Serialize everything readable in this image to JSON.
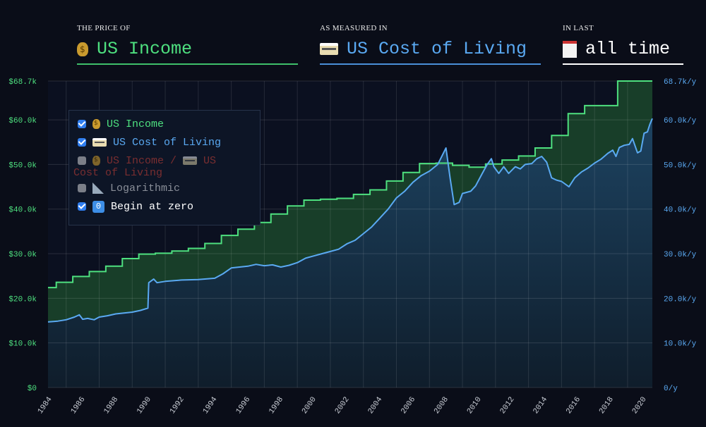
{
  "header": {
    "price_of": {
      "label": "THE PRICE OF",
      "value": "US Income",
      "icon": "money-bag-icon"
    },
    "measured_in": {
      "label": "AS MEASURED IN",
      "value": "US Cost of Living",
      "icon": "credit-card-icon"
    },
    "in_last": {
      "label": "IN LAST",
      "value": "all time",
      "icon": "spiral-notepad-icon"
    }
  },
  "legend": {
    "items": [
      {
        "label": "US Income",
        "checked": true,
        "icon": "money-bag-icon",
        "color": "#4ee07f"
      },
      {
        "label": "US Cost of Living",
        "checked": true,
        "icon": "credit-card-icon",
        "color": "#5aa9f2"
      },
      {
        "label_a": "US Income /",
        "label_b": "US",
        "label_c": "Cost of Living",
        "checked": false,
        "color": "#7a2e30"
      },
      {
        "label": "Logarithmic",
        "checked": false,
        "icon": "triangular-ruler-icon",
        "color": "#8a8f99"
      },
      {
        "label": "Begin at zero",
        "checked": true,
        "icon": "keycap-zero-icon",
        "icon_text": "0",
        "color": "#ffffff"
      }
    ]
  },
  "chart_data": {
    "type": "line",
    "title": "",
    "xlabel": "",
    "ylabel_left": "US Income",
    "ylabel_right": "US Cost of Living",
    "xlim": [
      1983.9,
      2020.5
    ],
    "ylim": [
      0,
      68.7
    ],
    "grid": true,
    "x_ticks": [
      "1984",
      "1986",
      "1988",
      "1990",
      "1992",
      "1994",
      "1996",
      "1998",
      "2000",
      "2002",
      "2004",
      "2006",
      "2008",
      "2010",
      "2012",
      "2014",
      "2016",
      "2018",
      "2020"
    ],
    "y_ticks_left": [
      "$0",
      "$10.0k",
      "$20.0k",
      "$30.0k",
      "$40.0k",
      "$50.0k",
      "$60.0k",
      "$68.7k"
    ],
    "y_ticks_right": [
      "0/y",
      "10.0k/y",
      "20.0k/y",
      "30.0k/y",
      "40.0k/y",
      "50.0k/y",
      "60.0k/y",
      "68.7k/y"
    ],
    "y_tick_values": [
      0,
      10,
      20,
      30,
      40,
      50,
      60,
      68.7
    ],
    "series": [
      {
        "name": "US Income",
        "unit": "k$",
        "style": "step",
        "color": "#4ee07f",
        "x": [
          1983.9,
          1984.4,
          1985.4,
          1986.4,
          1987.4,
          1988.4,
          1989.4,
          1990.4,
          1991.4,
          1992.4,
          1993.4,
          1994.4,
          1995.4,
          1996.4,
          1997.4,
          1998.4,
          1999.4,
          2000.4,
          2001.4,
          2002.4,
          2003.4,
          2004.4,
          2005.4,
          2006.4,
          2007.4,
          2008.4,
          2009.4,
          2010.4,
          2011.4,
          2012.4,
          2013.4,
          2014.4,
          2015.4,
          2016.4,
          2017.4,
          2018.4
        ],
        "values": [
          22.4,
          23.6,
          24.9,
          26.0,
          27.2,
          28.9,
          29.9,
          30.1,
          30.6,
          31.2,
          32.3,
          34.1,
          35.5,
          37.0,
          38.9,
          40.7,
          42.0,
          42.2,
          42.4,
          43.3,
          44.3,
          46.3,
          48.2,
          50.2,
          50.3,
          49.8,
          49.4,
          50.1,
          51.0,
          51.9,
          53.7,
          56.5,
          61.4,
          63.2,
          63.2,
          68.7
        ]
      },
      {
        "name": "US Cost of Living",
        "unit": "k$/y",
        "style": "line",
        "color": "#5aa9f2",
        "x": [
          1983.9,
          1984.5,
          1985,
          1985.5,
          1985.8,
          1986,
          1986.3,
          1986.7,
          1987,
          1987.5,
          1988,
          1988.5,
          1989,
          1989.5,
          1989.95,
          1990,
          1990.3,
          1990.5,
          1991,
          1992,
          1993,
          1994,
          1994.5,
          1995,
          1996,
          1996.5,
          1997,
          1997.5,
          1998,
          1998.5,
          1999,
          1999.5,
          2000,
          2000.5,
          2001,
          2001.5,
          2002,
          2002.5,
          2003,
          2003.5,
          2004,
          2004.5,
          2005,
          2005.5,
          2006,
          2006.5,
          2007,
          2007.5,
          2008,
          2008.25,
          2008.5,
          2008.8,
          2009,
          2009.5,
          2009.8,
          2010.2,
          2010.5,
          2010.75,
          2010.9,
          2011.2,
          2011.5,
          2011.8,
          2012.2,
          2012.5,
          2012.8,
          2013.2,
          2013.5,
          2013.8,
          2014.1,
          2014.4,
          2014.7,
          2015,
          2015.45,
          2015.8,
          2016.2,
          2016.6,
          2017,
          2017.4,
          2017.8,
          2018.1,
          2018.3,
          2018.5,
          2018.8,
          2019.1,
          2019.3,
          2019.6,
          2019.8,
          2020,
          2020.2,
          2020.35,
          2020.5
        ],
        "values": [
          14.7,
          14.9,
          15.2,
          15.8,
          16.3,
          15.3,
          15.5,
          15.2,
          15.8,
          16.1,
          16.5,
          16.7,
          16.9,
          17.3,
          17.8,
          23.5,
          24.3,
          23.5,
          23.8,
          24.1,
          24.2,
          24.5,
          25.5,
          26.8,
          27.2,
          27.6,
          27.3,
          27.5,
          27.0,
          27.4,
          28.0,
          29.0,
          29.5,
          30.0,
          30.5,
          31.0,
          32.2,
          33.0,
          34.5,
          36.0,
          38.0,
          40.0,
          42.5,
          44.0,
          46.0,
          47.5,
          48.5,
          50.0,
          53.7,
          47.0,
          41.0,
          41.5,
          43.5,
          44.0,
          45.2,
          48.0,
          50.0,
          51.3,
          49.5,
          48.0,
          49.5,
          48.0,
          49.5,
          49.0,
          50.0,
          50.2,
          51.3,
          51.8,
          50.5,
          47.0,
          46.5,
          46.2,
          45.0,
          47.0,
          48.3,
          49.2,
          50.3,
          51.2,
          52.5,
          53.2,
          51.8,
          53.8,
          54.3,
          54.5,
          55.8,
          52.6,
          53.0,
          57.0,
          57.3,
          59.0,
          60.3
        ]
      }
    ]
  }
}
